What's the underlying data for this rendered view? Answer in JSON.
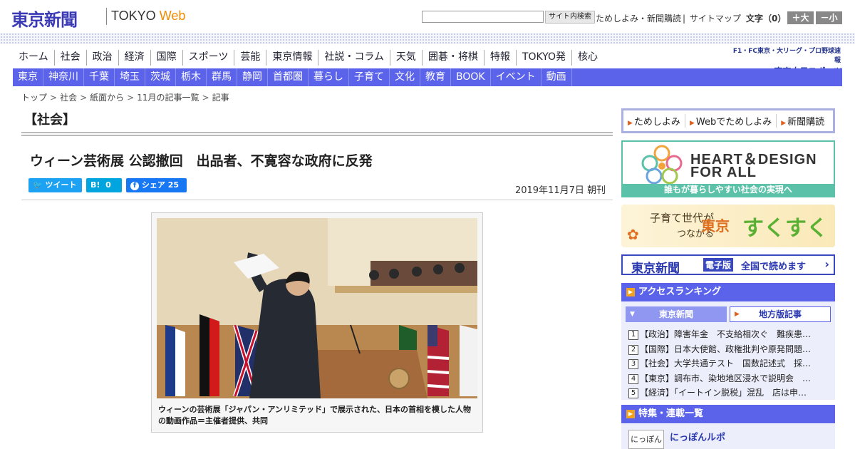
{
  "header": {
    "logo": "東京新聞",
    "logo_sub_a": "TOKYO ",
    "logo_sub_b": "Web",
    "search_placeholder": "",
    "search_button": "サイト内検索",
    "links": [
      "ためしよみ・新聞購読",
      "サイトマップ"
    ],
    "font_size_label": "文字（0）",
    "font_larger": "＋大",
    "font_smaller": "－小"
  },
  "nav_main": [
    "ホーム",
    "社会",
    "政治",
    "経済",
    "国際",
    "スポーツ",
    "芸能",
    "東京情報",
    "社説・コラム",
    "天気",
    "囲碁・将棋",
    "特報",
    "TOKYO発",
    "核心"
  ],
  "chunichi": {
    "line1": "F1・FC東京・大リーグ・プロ野球速報",
    "line2": "東京中日スポーツ"
  },
  "nav_region": [
    "東京",
    "神奈川",
    "千葉",
    "埼玉",
    "茨城",
    "栃木",
    "群馬",
    "静岡",
    "首都圏",
    "暮らし",
    "子育て",
    "文化",
    "教育",
    "BOOK",
    "イベント",
    "動画"
  ],
  "breadcrumb": [
    "トップ",
    "社会",
    "紙面から",
    "11月の記事一覧",
    "記事"
  ],
  "article": {
    "category": "【社会】",
    "title": "ウィーン芸術展 公認撤回　出品者、不寛容な政府に反発",
    "share_tweet": "ツイート",
    "share_hatena": "B!",
    "share_hatena_count": "0",
    "share_fb": "シェア",
    "share_fb_count": "25",
    "date": "2019年11月7日 朝刊",
    "caption": "ウィーンの芸術展「ジャパン・アンリミテッド」で展示された、日本の首相を模した人物の動画作品＝主催者提供、共同"
  },
  "sidebar": {
    "promo": [
      "ためしよみ",
      "Webでためしよみ",
      "新聞購読"
    ],
    "hd_line1": "HEART＆DESIGN",
    "hd_line2": "FOR ALL",
    "hd_band": "誰もが暮らしやすい社会の実現へ",
    "sk_a": "子育て世代が",
    "sk_b": "つながる",
    "sk_c": "東京",
    "sk_d": "すくすく",
    "ep_logo": "東京新聞",
    "ep_badge": "電子版",
    "ep_text": "全国で読めます",
    "ranking_head": "アクセスランキング",
    "ranking_tabs": [
      "東京新聞",
      "地方版記事"
    ],
    "ranking": [
      {
        "num": "1",
        "text": "【政治】障害年金　不支給相次ぐ　難疾患…"
      },
      {
        "num": "2",
        "text": "【国際】日本大使館、政権批判や原発問題…"
      },
      {
        "num": "3",
        "text": "【社会】大学共通テスト　国数記述式　採…"
      },
      {
        "num": "4",
        "text": "【東京】調布市、染地地区浸水で説明会　…"
      },
      {
        "num": "5",
        "text": "【経済】「イートイン脱税」混乱　店は申…"
      }
    ],
    "feature_head": "特集・連載一覧",
    "feature_thumb": "にっぽん",
    "feature_title": "にっぽんルポ"
  },
  "colors": {
    "nav_blue": "#5a63ea",
    "accent_orange": "#f3a31b",
    "hd_green": "#5bc1a8"
  }
}
